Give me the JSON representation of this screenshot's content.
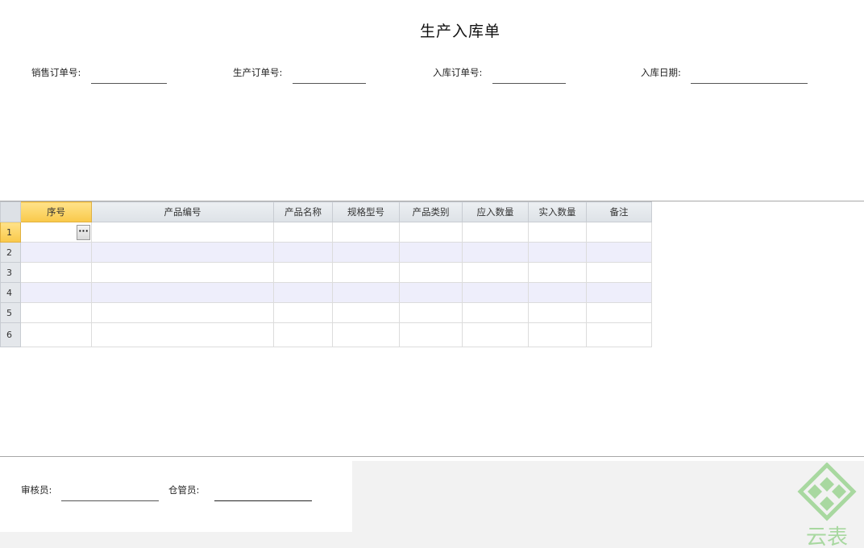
{
  "form": {
    "title": "生产入库单"
  },
  "header_fields": [
    {
      "label": "销售订单号:",
      "value": ""
    },
    {
      "label": "生产订单号:",
      "value": ""
    },
    {
      "label": "入库订单号:",
      "value": ""
    },
    {
      "label": "入库日期:",
      "value": ""
    }
  ],
  "grid": {
    "columns": [
      "序号",
      "产品编号",
      "产品名称",
      "规格型号",
      "产品类别",
      "应入数量",
      "实入数量",
      "备注"
    ],
    "row_numbers": [
      "1",
      "2",
      "3",
      "4",
      "5",
      "6"
    ],
    "ellipsis_label": "···",
    "active_column": "序号",
    "active_row": "1",
    "alt_row_color": "#eeeefb",
    "active_header_color": "#f9c94a"
  },
  "footer_fields": [
    {
      "label": "审核员:",
      "value": ""
    },
    {
      "label": "仓管员:",
      "value": ""
    }
  ],
  "logo": {
    "icon": "diamond-grid-logo-icon",
    "text": "云表",
    "color": "#a8d8a0"
  }
}
